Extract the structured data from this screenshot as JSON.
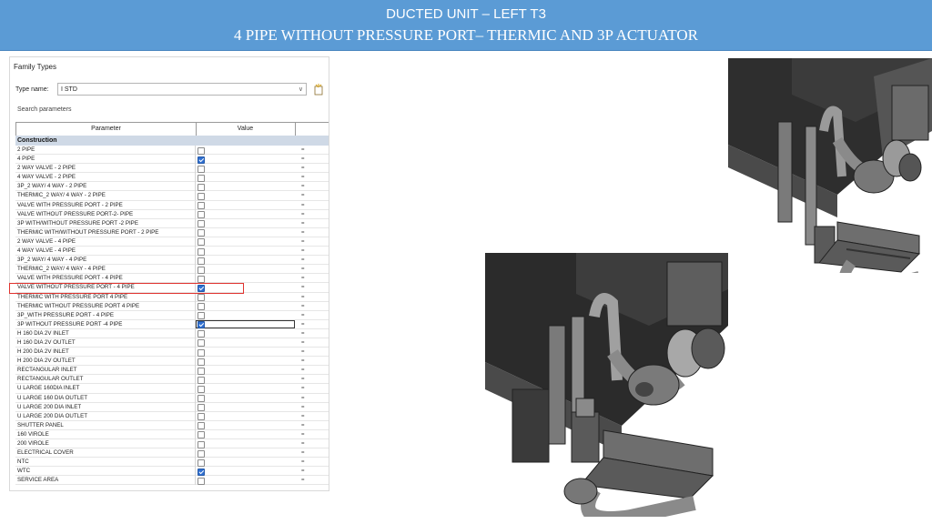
{
  "slide": {
    "title_line1": "DUCTED UNIT – LEFT T3",
    "title_line2": "4 PIPE WITHOUT PRESSURE PORT– THERMIC AND  3P ACTUATOR"
  },
  "family_types": {
    "window_title": "Family Types",
    "type_name_label": "Type name:",
    "type_name_value": "I STD",
    "search_placeholder": "Search parameters",
    "columns": [
      "Parameter",
      "Value"
    ],
    "group_name": "Construction",
    "parameters": [
      {
        "label": "2 PIPE",
        "checked": false
      },
      {
        "label": "4 PIPE",
        "checked": true
      },
      {
        "label": "2 WAY  VALVE - 2 PIPE",
        "checked": false
      },
      {
        "label": "4 WAY VALVE - 2 PIPE",
        "checked": false
      },
      {
        "label": "3P_2 WAY/ 4 WAY - 2 PIPE",
        "checked": false
      },
      {
        "label": "THERMIC_2 WAY/ 4 WAY - 2 PIPE",
        "checked": false
      },
      {
        "label": "VALVE WITH PRESSURE PORT - 2 PIPE",
        "checked": false
      },
      {
        "label": "VALVE WITHOUT PRESSURE PORT-2- PIPE",
        "checked": false
      },
      {
        "label": "3P WITH/WITHOUT PRESSURE PORT -2 PIPE",
        "checked": false
      },
      {
        "label": "THERMIC WITH/WITHOUT PRESSURE PORT - 2 PIPE",
        "checked": false
      },
      {
        "label": "2 WAY VALVE - 4 PIPE",
        "checked": false
      },
      {
        "label": "4 WAY VALVE - 4 PIPE",
        "checked": false
      },
      {
        "label": "3P_2 WAY/ 4 WAY - 4 PIPE",
        "checked": false
      },
      {
        "label": "THERMIC_2 WAY/ 4 WAY - 4 PIPE",
        "checked": false
      },
      {
        "label": "VALVE WITH PRESSURE PORT - 4 PIPE",
        "checked": false
      },
      {
        "label": "VALVE WITHOUT PRESSURE PORT - 4 PIPE",
        "checked": true
      },
      {
        "label": "THERMIC WITH PRESSURE PORT 4 PIPE",
        "checked": false
      },
      {
        "label": "THERMIC WITHOUT PRESSURE PORT  4 PIPE",
        "checked": false
      },
      {
        "label": "3P_WITH PRESSURE PORT - 4 PIPE",
        "checked": false
      },
      {
        "label": "3P WITHOUT PRESSURE PORT -4  PIPE",
        "checked": true
      },
      {
        "label": "H 160 DIA 2V INLET",
        "checked": false
      },
      {
        "label": "H 160 DIA 2V OUTLET",
        "checked": false
      },
      {
        "label": "H 200 DIA 2V INLET",
        "checked": false
      },
      {
        "label": "H 200 DIA 2V OUTLET",
        "checked": false
      },
      {
        "label": "RECTANGULAR INLET",
        "checked": false
      },
      {
        "label": "RECTANGULAR  OUTLET",
        "checked": false
      },
      {
        "label": "U LARGE 160DIA INLET",
        "checked": false
      },
      {
        "label": "U LARGE 160 DIA OUTLET",
        "checked": false
      },
      {
        "label": "U LARGE 200 DIA INLET",
        "checked": false
      },
      {
        "label": "U LARGE 200 DIA OUTLET",
        "checked": false
      },
      {
        "label": "SHUTTER PANEL",
        "checked": false
      },
      {
        "label": "160 VIROLE",
        "checked": false
      },
      {
        "label": "200 VIROLE",
        "checked": false
      },
      {
        "label": "ELECTRICAL COVER",
        "checked": false
      },
      {
        "label": "NTC",
        "checked": false
      },
      {
        "label": "WTC",
        "checked": true
      },
      {
        "label": "SERVICE AREA",
        "checked": false
      }
    ],
    "value_formula": "=",
    "highlighted_row": "VALVE WITHOUT PRESSURE PORT - 4 PIPE",
    "focused_row": "3P WITHOUT PRESSURE PORT -4  PIPE"
  },
  "colors": {
    "banner": "#5b9bd5",
    "highlight": "#e0332f",
    "checkbox_on": "#2f6fd1",
    "group_header": "#cfd9e6"
  }
}
